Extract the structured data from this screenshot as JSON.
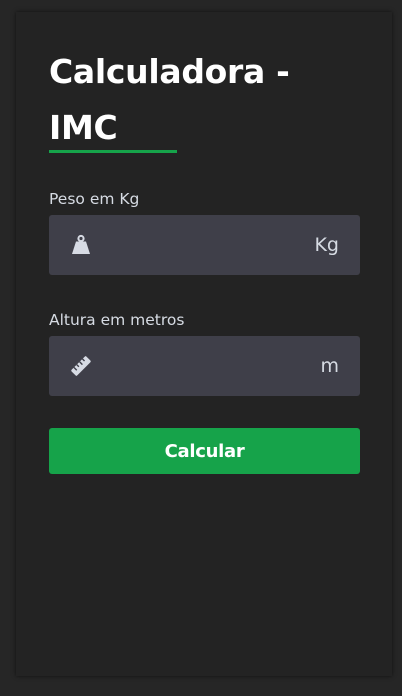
{
  "header": {
    "title": "Calculadora - IMC"
  },
  "form": {
    "weight": {
      "label": "Peso em Kg",
      "value": "",
      "unit": "Kg",
      "icon": "weight-icon"
    },
    "height": {
      "label": "Altura em metros",
      "value": "",
      "unit": "m",
      "icon": "ruler-icon"
    },
    "submit_label": "Calcular"
  },
  "colors": {
    "accent": "#16a34a",
    "background": "#262626",
    "card": "#232323",
    "input_background": "#3f3f49",
    "label_text": "#d6dbe3"
  }
}
